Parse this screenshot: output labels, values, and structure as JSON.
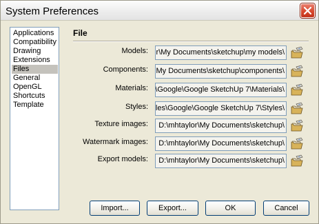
{
  "window": {
    "title": "System Preferences"
  },
  "sidebar": {
    "items": [
      {
        "label": "Applications"
      },
      {
        "label": "Compatibility"
      },
      {
        "label": "Drawing"
      },
      {
        "label": "Extensions"
      },
      {
        "label": "Files",
        "selected": true
      },
      {
        "label": "General"
      },
      {
        "label": "OpenGL"
      },
      {
        "label": "Shortcuts"
      },
      {
        "label": "Template"
      }
    ]
  },
  "panel": {
    "title": "File",
    "rows": [
      {
        "label": "Models:",
        "value": "r\\My Documents\\sketchup\\my models\\"
      },
      {
        "label": "Components:",
        "value": "My Documents\\sketchup\\components\\"
      },
      {
        "label": "Materials:",
        "value": "\\Google\\Google SketchUp 7\\Materials\\"
      },
      {
        "label": "Styles:",
        "value": "iles\\Google\\Google SketchUp 7\\Styles\\"
      },
      {
        "label": "Texture images:",
        "value": "D:\\mhtaylor\\My Documents\\sketchup\\"
      },
      {
        "label": "Watermark images:",
        "value": "D:\\mhtaylor\\My Documents\\sketchup\\"
      },
      {
        "label": "Export models:",
        "value": "D:\\mhtaylor\\My Documents\\sketchup\\"
      }
    ]
  },
  "buttons": {
    "import": "Import...",
    "export": "Export...",
    "ok": "OK",
    "cancel": "Cancel"
  },
  "icons": {
    "close": "close-icon",
    "browse": "folder-browse-icon"
  }
}
